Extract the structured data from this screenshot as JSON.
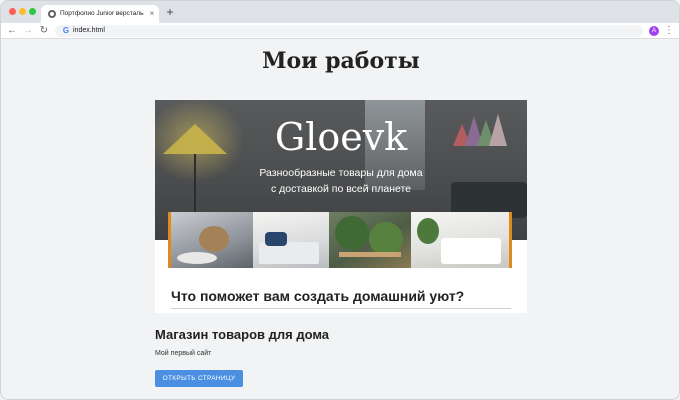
{
  "browser": {
    "tab_title": "Портфолио Junior верстальщ...",
    "tab_close": "×",
    "new_tab": "+",
    "url": "index.html",
    "profile_initial": "A",
    "nav": {
      "back": "←",
      "forward": "→",
      "reload": "↻",
      "menu": "⋮"
    },
    "search_engine_glyph": "G"
  },
  "page": {
    "title": "Мои работы",
    "preview": {
      "logo": "Gloevk",
      "tagline_line1": "Разнообразные товары для дома",
      "tagline_line2": "с доставкой по всей планете",
      "heading": "Что поможет вам создать домашний уют?"
    },
    "project": {
      "title": "Магазин товаров для дома",
      "description": "Мой первый сайт",
      "button_label": "ОТКРЫТЬ СТРАНИЦУ"
    }
  },
  "colors": {
    "accent_button": "#4a8fe2",
    "strip_border": "#e08a1e"
  },
  "icons": [
    "globe-icon",
    "close-icon",
    "plus-icon",
    "back-arrow-icon",
    "forward-arrow-icon",
    "reload-icon",
    "google-icon",
    "kebab-menu-icon"
  ]
}
